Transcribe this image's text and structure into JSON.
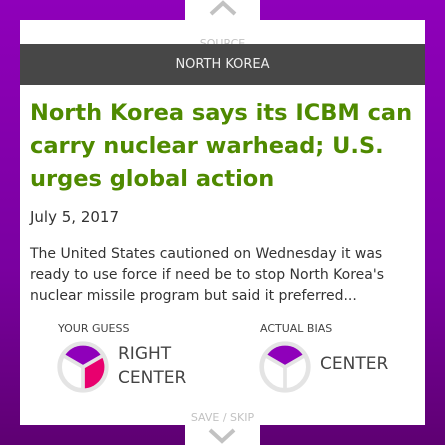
{
  "nav": {
    "source_label": "SOURCE",
    "save_skip_label": "SAVE / SKIP"
  },
  "article": {
    "category": "NORTH KOREA",
    "title": "North Korea says its ICBM can carry nuclear warhead; U.S. urges global action",
    "date": "July 5, 2017",
    "summary": "The United States cautioned on Wednesday it was ready to use force if need be to stop North Korea's nuclear missile program but said it preferred..."
  },
  "guess": {
    "label": "YOUR GUESS",
    "line1": "RIGHT",
    "line2": "CENTER"
  },
  "actual": {
    "label": "ACTUAL BIAS",
    "value": "CENTER"
  },
  "colors": {
    "center": "#8f00ba",
    "right": "#e8006e",
    "title": "#4f8a00"
  }
}
